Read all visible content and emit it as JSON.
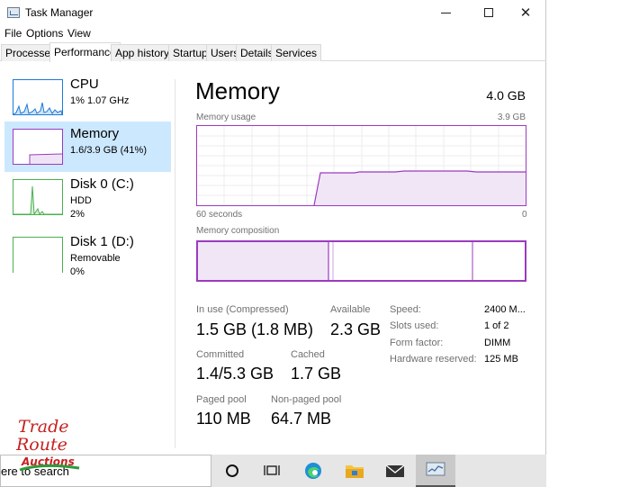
{
  "window": {
    "title": "Task Manager"
  },
  "menu": [
    "File",
    "Options",
    "View"
  ],
  "tabs": [
    {
      "label": "Processes"
    },
    {
      "label": "Performance",
      "active": true
    },
    {
      "label": "App history"
    },
    {
      "label": "Startup"
    },
    {
      "label": "Users"
    },
    {
      "label": "Details"
    },
    {
      "label": "Services"
    }
  ],
  "sidebar": {
    "items": [
      {
        "name": "CPU",
        "line1": "1%  1.07 GHz",
        "line2": ""
      },
      {
        "name": "Memory",
        "line1": "1.6/3.9 GB (41%)",
        "line2": "",
        "selected": true
      },
      {
        "name": "Disk 0 (C:)",
        "line1": "HDD",
        "line2": "2%"
      },
      {
        "name": "Disk 1 (D:)",
        "line1": "Removable",
        "line2": "0%"
      }
    ]
  },
  "main": {
    "title": "Memory",
    "total": "4.0 GB",
    "usage_label": "Memory usage",
    "usage_max": "3.9 GB",
    "time_left": "60 seconds",
    "time_right": "0",
    "composition_label": "Memory composition",
    "stats": {
      "in_use_label": "In use (Compressed)",
      "in_use_value": "1.5 GB (1.8 MB)",
      "available_label": "Available",
      "available_value": "2.3 GB",
      "committed_label": "Committed",
      "committed_value": "1.4/5.3 GB",
      "cached_label": "Cached",
      "cached_value": "1.7 GB",
      "paged_label": "Paged pool",
      "paged_value": "110 MB",
      "nonpaged_label": "Non-paged pool",
      "nonpaged_value": "64.7 MB"
    },
    "details": [
      {
        "key": "Speed:",
        "value": "2400 M..."
      },
      {
        "key": "Slots used:",
        "value": "1 of 2"
      },
      {
        "key": "Form factor:",
        "value": "DIMM"
      },
      {
        "key": "Hardware reserved:",
        "value": "125 MB"
      }
    ]
  },
  "taskbar": {
    "search_text": "ere to search"
  },
  "logo": {
    "line1": "Trade",
    "line2": "Route",
    "line3": "Auctions"
  },
  "colors": {
    "accent": "#9b3bbf",
    "selected_bg": "#cce8ff",
    "cpu_line": "#1c7ad9",
    "disk_line": "#4caf50"
  }
}
